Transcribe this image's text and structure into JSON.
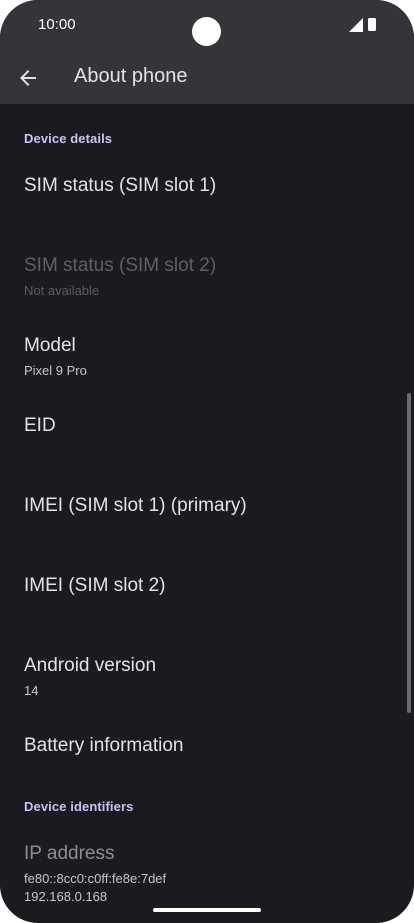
{
  "status_bar": {
    "time": "10:00"
  },
  "app_bar": {
    "title": "About phone"
  },
  "sections": {
    "device_details": "Device details",
    "device_identifiers": "Device identifiers"
  },
  "items": {
    "sim1": {
      "title": "SIM status (SIM slot 1)"
    },
    "sim2": {
      "title": "SIM status (SIM slot 2)",
      "subtitle": "Not available"
    },
    "model": {
      "title": "Model",
      "subtitle": "Pixel 9 Pro"
    },
    "eid": {
      "title": "EID"
    },
    "imei1": {
      "title": "IMEI (SIM slot 1) (primary)"
    },
    "imei2": {
      "title": "IMEI (SIM slot 2)"
    },
    "android": {
      "title": "Android version",
      "subtitle": "14"
    },
    "battery": {
      "title": "Battery information"
    },
    "ip": {
      "title": "IP address",
      "subtitle_lines": [
        "fe80::8cc0:c0ff:fe8e:7def",
        "192.168.0.168"
      ]
    }
  },
  "icons": {
    "back": "arrow-back-icon",
    "signal": "signal-icon",
    "battery": "battery-icon"
  },
  "colors": {
    "background": "#1b1b1f",
    "app_bar": "#333538",
    "section_header": "#c7c4f4",
    "text_primary": "#e6e1e5",
    "text_disabled": "#605e66"
  }
}
